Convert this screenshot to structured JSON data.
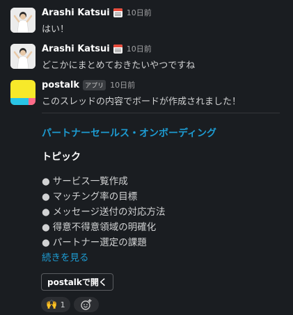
{
  "messages": [
    {
      "author": "Arashi Katsui",
      "time": "10日前",
      "text": "はい！",
      "avatar_icon": "person-avatar",
      "status_icon": "calendar-icon"
    },
    {
      "author": "Arashi Katsui",
      "time": "10日前",
      "text": "どこかにまとめておきたいやつですね",
      "avatar_icon": "person-avatar",
      "status_icon": "calendar-icon"
    },
    {
      "author": "postalk",
      "badge": "アプリ",
      "time": "10日前",
      "text": "このスレッドの内容でボードが作成されました！",
      "avatar_icon": "postalk-logo"
    }
  ],
  "card": {
    "title": "パートナーセールス・オンボーディング",
    "section_title": "トピック",
    "items": [
      "サービス一覧作成",
      "マッチング率の目標",
      "メッセージ送付の対応方法",
      "得意不得意領域の明確化",
      "パートナー選定の課題"
    ],
    "bullet": "●",
    "more_link": "続きを見る",
    "open_button": "postalkで開く"
  },
  "reactions": [
    {
      "emoji": "🙌",
      "count": "1"
    }
  ],
  "add_reaction_icon": "add-emoji-icon",
  "colors": {
    "background": "#1a1d21",
    "link": "#1d9bd1",
    "postalk_yellow": "#f7e92a",
    "postalk_cyan": "#29c4e6",
    "postalk_pink": "#ff6b8a"
  }
}
